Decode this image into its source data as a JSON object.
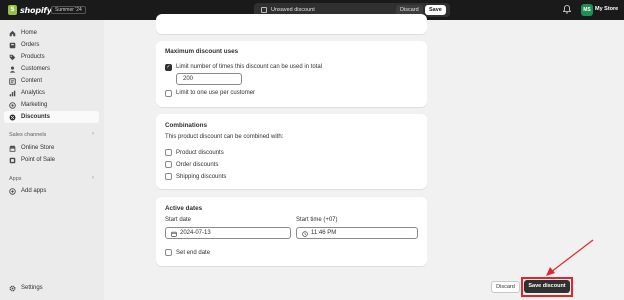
{
  "topbar": {
    "brand": "shopify",
    "edition": "Summer '24",
    "unsaved_message": "Unsaved discount",
    "discard_label": "Discard",
    "save_label": "Save",
    "avatar_initials": "MS",
    "store_name": "My Store"
  },
  "sidebar": {
    "main_items": [
      {
        "label": "Home",
        "icon": "home-icon"
      },
      {
        "label": "Orders",
        "icon": "orders-icon"
      },
      {
        "label": "Products",
        "icon": "tag-icon"
      },
      {
        "label": "Customers",
        "icon": "person-icon"
      },
      {
        "label": "Content",
        "icon": "content-icon"
      },
      {
        "label": "Analytics",
        "icon": "chart-icon"
      },
      {
        "label": "Marketing",
        "icon": "target-icon"
      },
      {
        "label": "Discounts",
        "icon": "discount-icon",
        "active": true
      }
    ],
    "sales_channels_label": "Sales channels",
    "sales_channels": [
      {
        "label": "Online Store",
        "icon": "store-icon"
      },
      {
        "label": "Point of Sale",
        "icon": "pos-icon"
      }
    ],
    "apps_label": "Apps",
    "add_apps_label": "Add apps",
    "settings_label": "Settings"
  },
  "max_uses": {
    "title": "Maximum discount uses",
    "limit_total_label": "Limit number of times this discount can be used in total",
    "limit_total_checked": true,
    "limit_total_value": "200",
    "limit_per_customer_label": "Limit to one use per customer",
    "limit_per_customer_checked": false
  },
  "combinations": {
    "title": "Combinations",
    "description": "This product discount can be combined with:",
    "options": [
      "Product discounts",
      "Order discounts",
      "Shipping discounts"
    ]
  },
  "active_dates": {
    "title": "Active dates",
    "start_date_label": "Start date",
    "start_date_value": "2024-07-13",
    "start_time_label": "Start time (+07)",
    "start_time_value": "11:46 PM",
    "set_end_date_label": "Set end date"
  },
  "footer": {
    "discard_label": "Discard",
    "save_label": "Save discount"
  },
  "colors": {
    "topbar_bg": "#1a1a1a",
    "primary_button": "#303030",
    "avatar_bg": "#1f8f55",
    "highlight": "#e5232d"
  }
}
